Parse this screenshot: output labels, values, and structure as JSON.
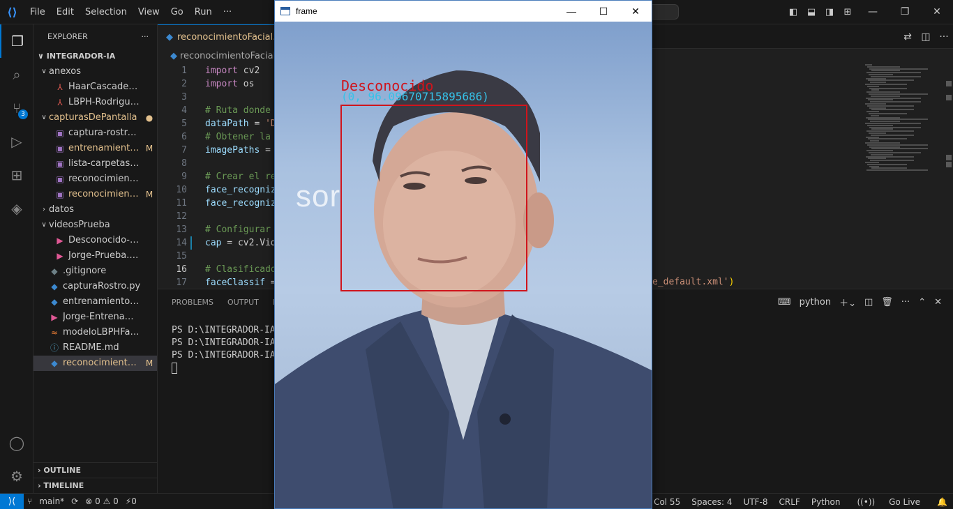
{
  "menu": [
    "File",
    "Edit",
    "Selection",
    "View",
    "Go",
    "Run",
    "···"
  ],
  "activity": {
    "scm_badge": "3"
  },
  "explorer": {
    "header": "EXPLORER",
    "more": "···",
    "root": "INTEGRADOR-IA",
    "items": [
      {
        "label": "anexos",
        "chev": "∨",
        "icon": "",
        "status": "",
        "cls": "txt"
      },
      {
        "label": "HaarCascades-Rodrig...",
        "chev": "",
        "icon": "pdf-icon",
        "status": "",
        "cls": "txt"
      },
      {
        "label": "LBPH-RodriguezJorge...",
        "chev": "",
        "icon": "pdf-icon",
        "status": "",
        "cls": "txt"
      },
      {
        "label": "capturasDePantalla",
        "chev": "∨",
        "icon": "",
        "status": "●",
        "cls": "mod"
      },
      {
        "label": "captura-rostro.jpg",
        "chev": "",
        "icon": "image-icon",
        "status": "",
        "cls": "txt"
      },
      {
        "label": "entrenamiento.j...",
        "chev": "",
        "icon": "image-icon",
        "status": "M",
        "cls": "mod"
      },
      {
        "label": "lista-carpetas-archivo...",
        "chev": "",
        "icon": "image-icon",
        "status": "",
        "cls": "txt"
      },
      {
        "label": "reconocimiento-desc...",
        "chev": "",
        "icon": "image-icon",
        "status": "",
        "cls": "txt"
      },
      {
        "label": "reconocimiento...",
        "chev": "",
        "icon": "image-icon",
        "status": "M",
        "cls": "mod"
      },
      {
        "label": "datos",
        "chev": "›",
        "icon": "",
        "status": "",
        "cls": "txt"
      },
      {
        "label": "videosPrueba",
        "chev": "∨",
        "icon": "",
        "status": "",
        "cls": "txt"
      },
      {
        "label": "Desconocido-Prueba....",
        "chev": "",
        "icon": "video-icon",
        "status": "",
        "cls": "txt"
      },
      {
        "label": "Jorge-Prueba.mp4",
        "chev": "",
        "icon": "video-icon",
        "status": "",
        "cls": "txt"
      },
      {
        "label": ".gitignore",
        "chev": "",
        "icon": "git-icon",
        "status": "",
        "cls": "txt"
      },
      {
        "label": "capturaRostro.py",
        "chev": "",
        "icon": "python-icon",
        "status": "",
        "cls": "txt"
      },
      {
        "label": "entrenamientoLBPH.py",
        "chev": "",
        "icon": "python-icon",
        "status": "",
        "cls": "txt"
      },
      {
        "label": "Jorge-Entrenamiento....",
        "chev": "",
        "icon": "video-icon",
        "status": "",
        "cls": "txt"
      },
      {
        "label": "modeloLBPHFace.xml",
        "chev": "",
        "icon": "xml-icon",
        "status": "",
        "cls": "txt"
      },
      {
        "label": "README.md",
        "chev": "",
        "icon": "info-icon",
        "status": "",
        "cls": "txt"
      },
      {
        "label": "reconocimientoF...",
        "chev": "",
        "icon": "python-icon",
        "status": "M",
        "cls": "mod"
      }
    ],
    "outline": "OUTLINE",
    "timeline": "TIMELINE"
  },
  "editor": {
    "tab_label": "reconocimientoFacial.py",
    "breadcrumb": "reconocimientoFacial.py",
    "lines": [
      {
        "n": "1",
        "segs": [
          {
            "t": "import",
            "c": "kw"
          },
          {
            "t": " cv2",
            "c": "txt"
          }
        ]
      },
      {
        "n": "2",
        "segs": [
          {
            "t": "import",
            "c": "kw"
          },
          {
            "t": " os",
            "c": "txt"
          }
        ]
      },
      {
        "n": "3",
        "segs": []
      },
      {
        "n": "4",
        "segs": [
          {
            "t": "# Ruta donde",
            "c": "cm"
          }
        ]
      },
      {
        "n": "5",
        "segs": [
          {
            "t": "dataPath",
            "c": "var"
          },
          {
            "t": " = ",
            "c": "txt"
          },
          {
            "t": "'D",
            "c": "str"
          }
        ]
      },
      {
        "n": "6",
        "segs": [
          {
            "t": "# Obtener la",
            "c": "cm"
          }
        ]
      },
      {
        "n": "7",
        "segs": [
          {
            "t": "imagePaths",
            "c": "var"
          },
          {
            "t": " =",
            "c": "txt"
          }
        ]
      },
      {
        "n": "8",
        "segs": []
      },
      {
        "n": "9",
        "segs": [
          {
            "t": "# Crear el re",
            "c": "cm"
          }
        ]
      },
      {
        "n": "10",
        "segs": [
          {
            "t": "face_recogniz",
            "c": "var"
          }
        ]
      },
      {
        "n": "11",
        "segs": [
          {
            "t": "face_recogniz",
            "c": "var"
          }
        ]
      },
      {
        "n": "12",
        "segs": []
      },
      {
        "n": "13",
        "segs": [
          {
            "t": "# Configurar",
            "c": "cm"
          }
        ]
      },
      {
        "n": "14",
        "segs": [
          {
            "t": "cap",
            "c": "var"
          },
          {
            "t": " = cv2.Vid",
            "c": "txt"
          }
        ]
      },
      {
        "n": "15",
        "segs": []
      },
      {
        "n": "16",
        "segs": [
          {
            "t": "# Clasificado",
            "c": "cm"
          }
        ]
      },
      {
        "n": "17",
        "segs": [
          {
            "t": "faceClassif",
            "c": "var"
          },
          {
            "t": " =",
            "c": "txt"
          }
        ]
      }
    ],
    "current_line": "16",
    "tail_str": "e_default.xml'",
    "tail_paren": ")"
  },
  "panel": {
    "tabs": [
      "PROBLEMS",
      "OUTPUT",
      "D"
    ],
    "terminal_name": "python",
    "lines": [
      "PS D:\\INTEGRADOR-IA>",
      "PS D:\\INTEGRADOR-IA>",
      "PS D:\\INTEGRADOR-IA>"
    ]
  },
  "statusbar": {
    "branch": "main*",
    "sync": "⟳",
    "errors": "⊗ 0 ⚠ 0",
    "ports": "⚡0",
    "position": "Ln 16, Col 55",
    "spaces": "Spaces: 4",
    "encoding": "UTF-8",
    "eol": "CRLF",
    "language": "Python",
    "golive": "Go Live"
  },
  "frame_window": {
    "title": "frame",
    "bg_text": "sor",
    "label": "Desconocido",
    "confidence": "(0, 96.09670715895686)"
  },
  "colors": {
    "accent": "#0078d4",
    "detect_box": "#d0141c",
    "confidence_text": "#36c2e8",
    "modified": "#e2c08d"
  }
}
